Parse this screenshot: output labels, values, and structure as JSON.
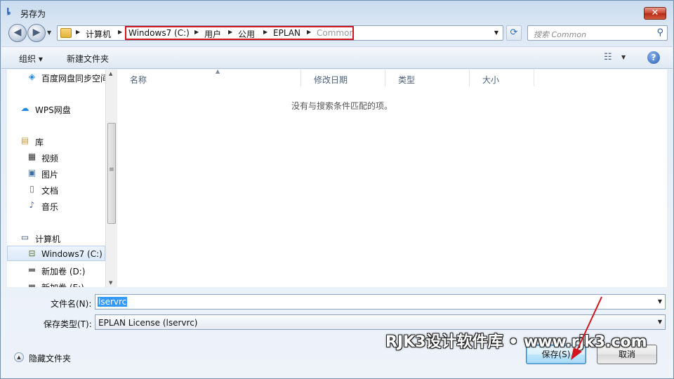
{
  "window": {
    "title": "另存为",
    "close_glyph": "✕"
  },
  "nav": {
    "back_glyph": "◀",
    "forward_glyph": "▶"
  },
  "address": {
    "breadcrumbs": [
      "计算机",
      "Windows7 (C:)",
      "用户",
      "公用",
      "EPLAN",
      "Common"
    ]
  },
  "search": {
    "placeholder": "搜索 Common"
  },
  "toolbar": {
    "organize": "组织 ▾",
    "new_folder": "新建文件夹"
  },
  "sidebar": {
    "items": [
      {
        "label": "百度网盘同步空间",
        "icon": "baidu-netdisk-icon"
      },
      {
        "label": "WPS网盘",
        "icon": "wps-cloud-icon"
      },
      {
        "label": "库",
        "icon": "library-icon"
      },
      {
        "label": "视频",
        "icon": "video-icon"
      },
      {
        "label": "图片",
        "icon": "picture-icon"
      },
      {
        "label": "文档",
        "icon": "document-icon"
      },
      {
        "label": "音乐",
        "icon": "music-icon"
      },
      {
        "label": "计算机",
        "icon": "computer-icon"
      },
      {
        "label": "Windows7 (C:)",
        "icon": "drive-c-icon"
      },
      {
        "label": "新加卷 (D:)",
        "icon": "drive-icon"
      },
      {
        "label": "新加卷 (E:)",
        "icon": "drive-icon"
      }
    ]
  },
  "file_list": {
    "columns": [
      "名称",
      "修改日期",
      "类型",
      "大小"
    ],
    "empty_message": "没有与搜索条件匹配的项。"
  },
  "form": {
    "filename_label": "文件名(N):",
    "filename_value": "lservrc",
    "filetype_label": "保存类型(T):",
    "filetype_value": "EPLAN License (lservrc)"
  },
  "footer": {
    "hide_folders": "隐藏文件夹",
    "save_button": "保存(S)",
    "cancel_button": "取消"
  },
  "watermark": {
    "text": "RJK3设计软件库 • www.rjk3.com"
  },
  "colors": {
    "highlight_border": "#d2141c",
    "selection": "#3399ff"
  }
}
